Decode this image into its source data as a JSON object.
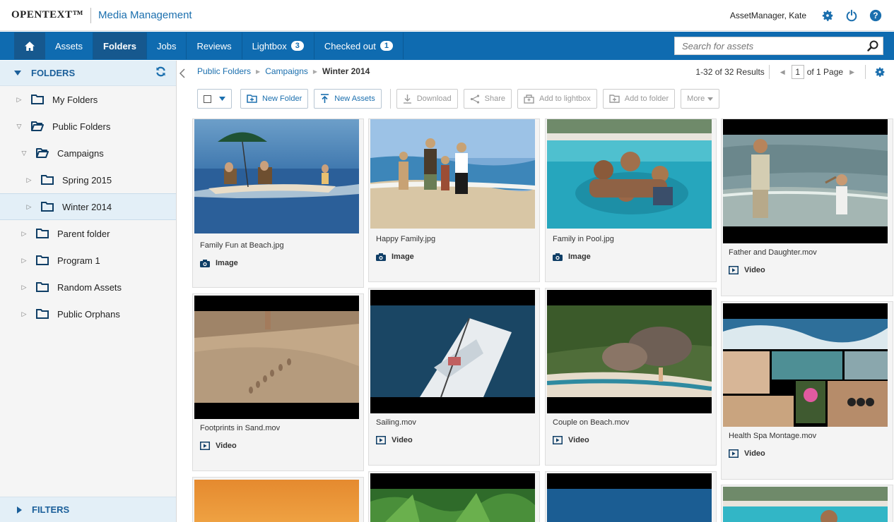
{
  "header": {
    "logo": "OPENTEXT™",
    "app_title": "Media Management",
    "user": "AssetManager, Kate",
    "icons": [
      "gear-icon",
      "power-icon",
      "help-icon"
    ]
  },
  "nav": {
    "home_icon": "home-icon",
    "items": [
      {
        "label": "Assets"
      },
      {
        "label": "Folders",
        "active": true
      },
      {
        "label": "Jobs"
      },
      {
        "label": "Reviews"
      },
      {
        "label": "Lightbox",
        "badge": "3"
      },
      {
        "label": "Checked out",
        "badge": "1"
      }
    ],
    "search_placeholder": "Search for assets"
  },
  "sidebar": {
    "title": "FOLDERS",
    "footer": "FILTERS",
    "tree": [
      {
        "label": "My Folders",
        "expanded": false
      },
      {
        "label": "Public Folders",
        "expanded": true
      },
      {
        "label": "Campaigns",
        "expanded": true
      },
      {
        "label": "Spring 2015",
        "expanded": false
      },
      {
        "label": "Winter 2014",
        "expanded": false,
        "selected": true
      },
      {
        "label": "Parent folder",
        "expanded": false
      },
      {
        "label": "Program 1",
        "expanded": false
      },
      {
        "label": "Random Assets",
        "expanded": false
      },
      {
        "label": "Public Orphans",
        "expanded": false
      }
    ]
  },
  "breadcrumb": {
    "items": [
      "Public Folders",
      "Campaigns"
    ],
    "current": "Winter 2014"
  },
  "results": {
    "summary": "1-32 of 32 Results",
    "page": "1",
    "page_of": "of 1 Page"
  },
  "toolbar": {
    "new_folder": "New Folder",
    "new_assets": "New Assets",
    "download": "Download",
    "share": "Share",
    "add_lightbox": "Add to lightbox",
    "add_folder": "Add to folder",
    "more": "More"
  },
  "colors": {
    "brand_blue": "#0f6bb0",
    "nav_active": "#16588e",
    "link": "#1b6fae"
  },
  "assets": [
    {
      "name": "Family Fun at Beach.jpg",
      "type": "Image"
    },
    {
      "name": "Happy Family.jpg",
      "type": "Image"
    },
    {
      "name": "Family in Pool.jpg",
      "type": "Image"
    },
    {
      "name": "Father and Daughter.mov",
      "type": "Video"
    },
    {
      "name": "Footprints in Sand.mov",
      "type": "Video"
    },
    {
      "name": "Sailing.mov",
      "type": "Video"
    },
    {
      "name": "Couple on Beach.mov",
      "type": "Video"
    },
    {
      "name": "Health Spa Montage.mov",
      "type": "Video"
    }
  ]
}
